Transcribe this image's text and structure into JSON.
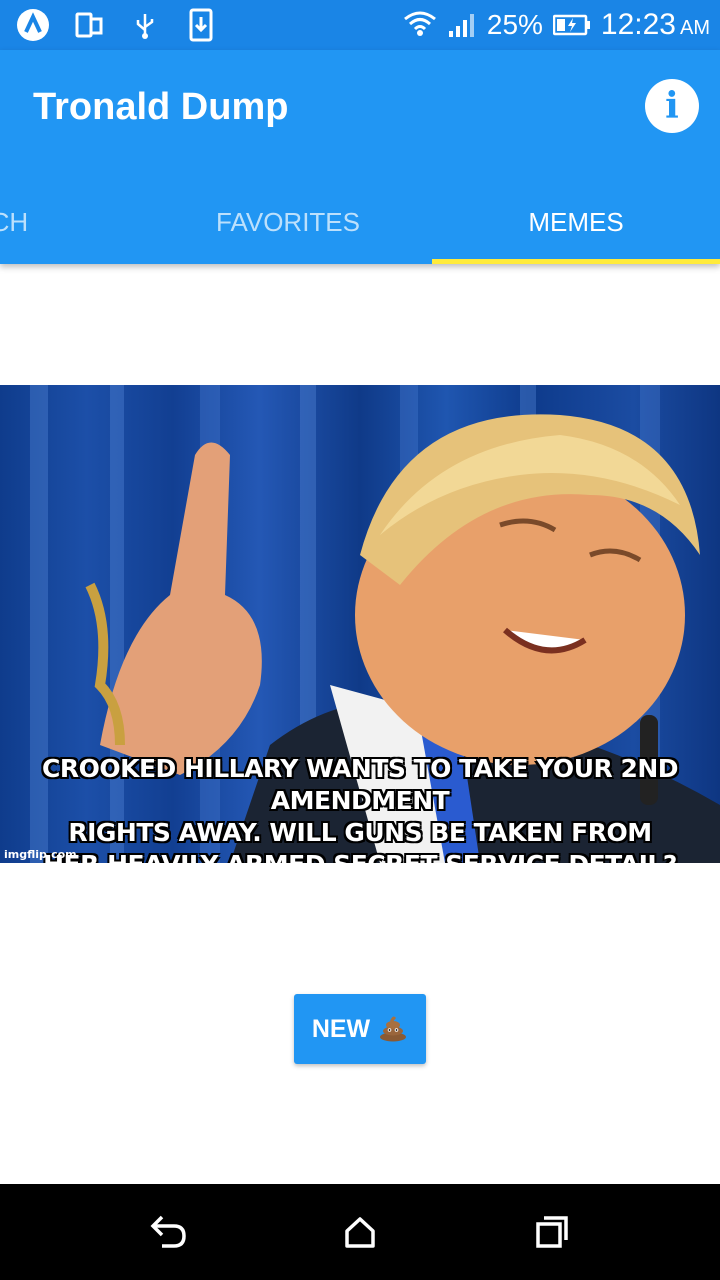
{
  "status_bar": {
    "battery_percent": "25%",
    "time": "12:23",
    "ampm": "AM",
    "icons": [
      "app-notification-icon",
      "screen-rotation-icon",
      "usb-icon",
      "download-icon",
      "wifi-icon",
      "signal-icon",
      "battery-charging-icon"
    ]
  },
  "app_bar": {
    "title": "Tronald Dump",
    "info_icon": "info-icon",
    "color": "#2196f3"
  },
  "tabs": [
    {
      "label": "RCH",
      "active": false
    },
    {
      "label": "FAVORITES",
      "active": false
    },
    {
      "label": "MEMES",
      "active": true
    }
  ],
  "tab_indicator_color": "#ffeb3b",
  "meme": {
    "caption_lines": [
      "CROOKED HILLARY WANTS TO TAKE YOUR 2ND AMENDMENT",
      "RIGHTS AWAY. WILL GUNS BE TAKEN FROM",
      "HER HEAVILY ARMED SECRET SERVICE DETAIL? MAYBE NOT!"
    ],
    "watermark": "imgflip.com"
  },
  "new_button": {
    "label": "NEW",
    "emoji": "💩"
  },
  "nav_bar": {
    "icons": [
      "back-icon",
      "home-icon",
      "recents-icon"
    ]
  }
}
